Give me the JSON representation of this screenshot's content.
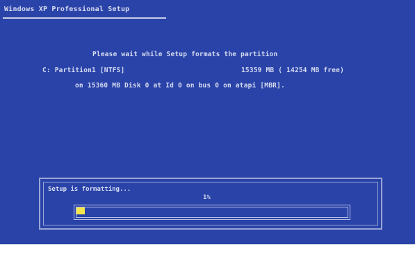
{
  "window": {
    "title": "Windows XP Professional Setup"
  },
  "message": {
    "line1": "Please wait while Setup formats the partition",
    "line2_left": "C:  Partition1 [NTFS]",
    "line2_right": "15359 MB ( 14254 MB free)",
    "line3": "on 15360 MB Disk 0 at Id 0 on bus 0 on atapi [MBR]."
  },
  "progress": {
    "status": "Setup is formatting...",
    "percent_label": "1%",
    "percent_value": 0.03
  },
  "colors": {
    "background": "#2a43a8",
    "text": "#d6dcf2",
    "progress_fill": "#f3e54a"
  }
}
